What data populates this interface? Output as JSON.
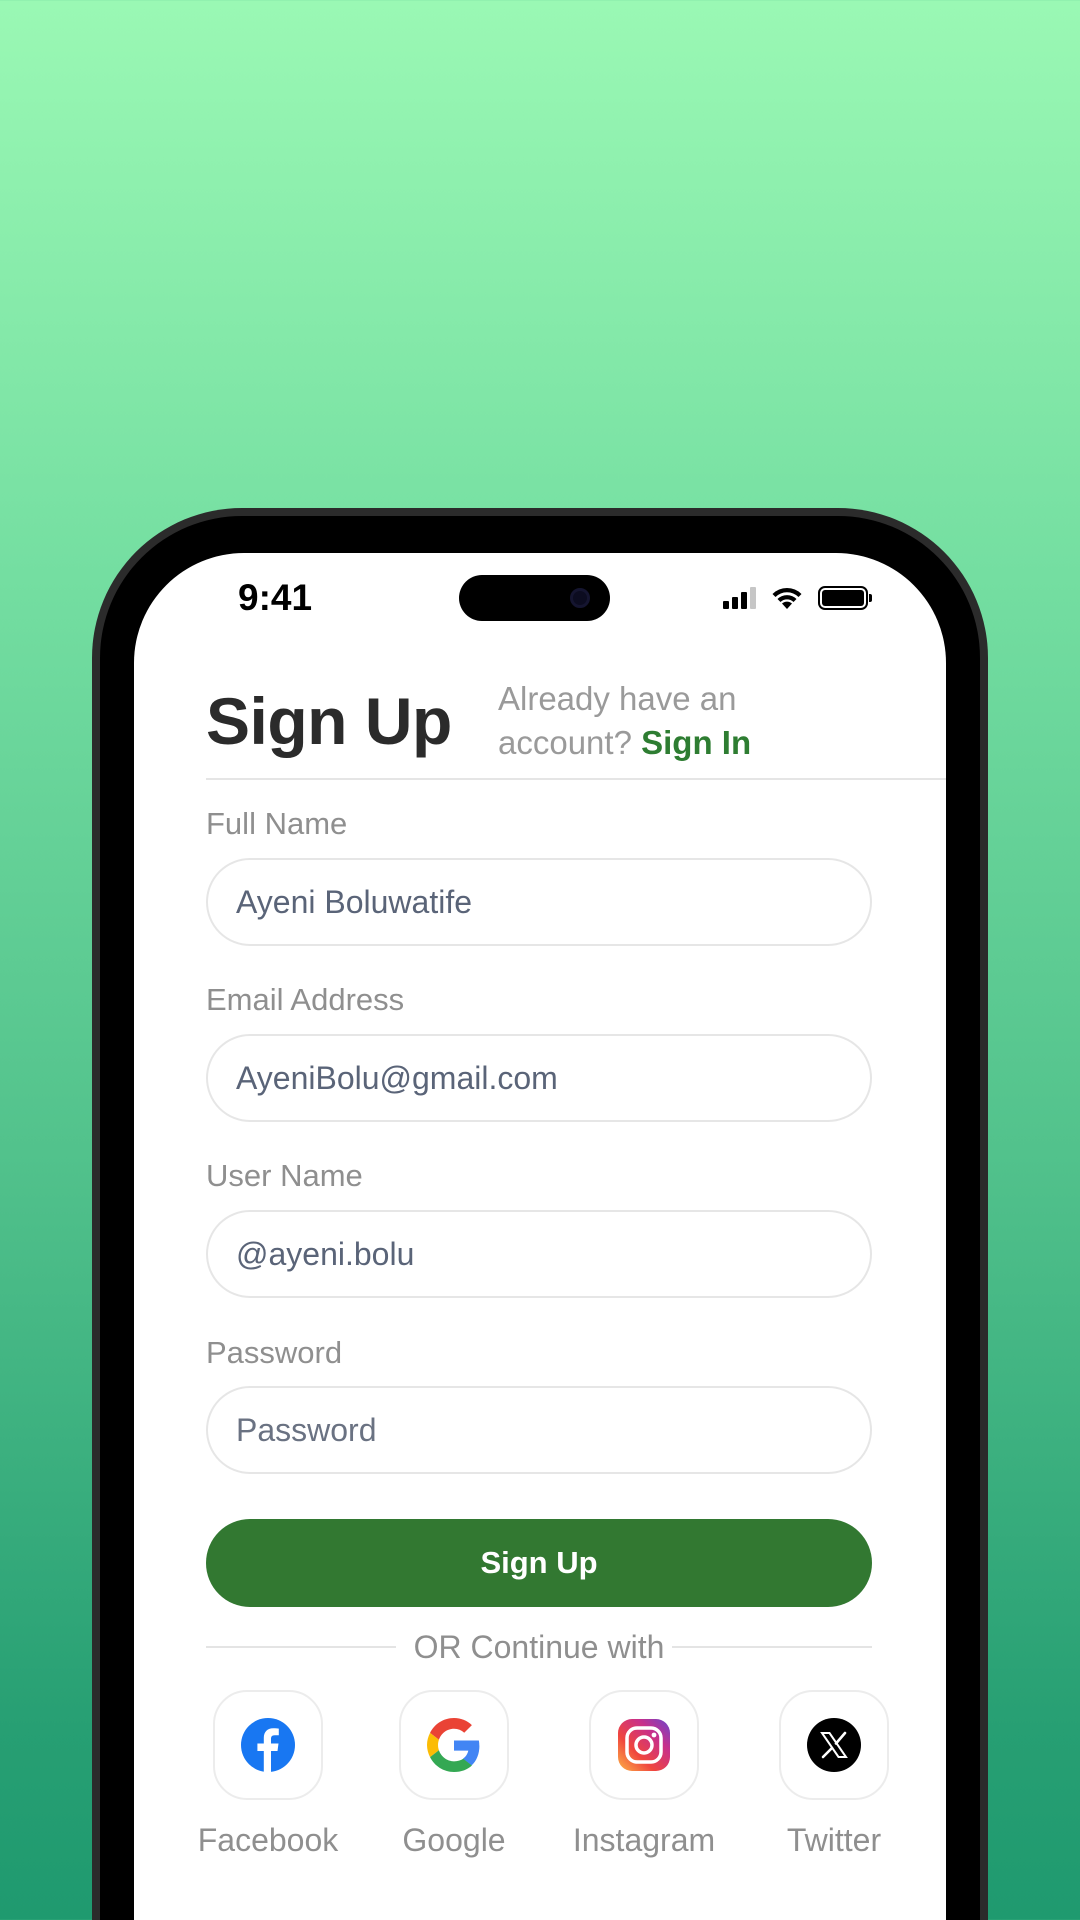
{
  "status_bar": {
    "time": "9:41"
  },
  "header": {
    "title": "Sign Up",
    "already_text": "Already have an account?",
    "sign_in_link": "Sign In"
  },
  "form": {
    "full_name": {
      "label": "Full Name",
      "value": "Ayeni Boluwatife"
    },
    "email": {
      "label": "Email Address",
      "value": "AyeniBolu@gmail.com"
    },
    "username": {
      "label": "User Name",
      "value": "@ayeni.bolu"
    },
    "password": {
      "label": "Password",
      "placeholder": "Password",
      "value": ""
    },
    "submit_label": "Sign Up"
  },
  "divider_text": "OR Continue with",
  "socials": [
    {
      "label": "Facebook",
      "icon": "facebook-icon"
    },
    {
      "label": "Google",
      "icon": "google-icon"
    },
    {
      "label": "Instagram",
      "icon": "instagram-icon"
    },
    {
      "label": "Twitter",
      "icon": "x-twitter-icon"
    }
  ],
  "colors": {
    "accent": "#327831",
    "link": "#2e7d32",
    "background_top": "#9af8b4",
    "background_bottom": "#1f9a6f"
  }
}
